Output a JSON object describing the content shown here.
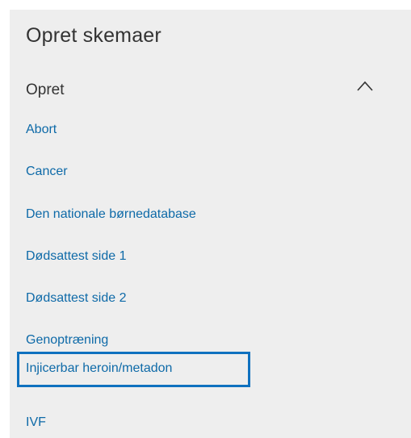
{
  "panel": {
    "title": "Opret skemaer"
  },
  "section": {
    "title": "Opret",
    "expanded_icon": "chevron-up-icon",
    "items": [
      {
        "label": "Abort"
      },
      {
        "label": "Cancer"
      },
      {
        "label": "Den nationale børnedatabase"
      },
      {
        "label": "Dødsattest side 1"
      },
      {
        "label": "Dødsattest side 2"
      },
      {
        "label": "Genoptræning"
      },
      {
        "label": "Injicerbar heroin/metadon"
      },
      {
        "label": "IVF"
      }
    ]
  },
  "colors": {
    "panel_bg": "#eeeeee",
    "link": "#0e6aa8",
    "selection_border": "#0f71bf",
    "heading": "#333333"
  }
}
